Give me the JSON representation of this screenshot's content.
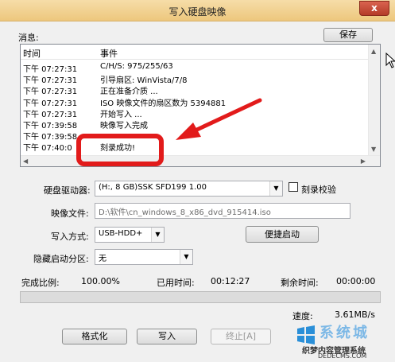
{
  "window": {
    "title": "写入硬盘映像",
    "close_label": "x"
  },
  "messages": {
    "label": "消息:",
    "save_label": "保存",
    "col_time": "时间",
    "col_event": "事件",
    "rows": [
      {
        "time": "下午 07:27:31",
        "event": "C/H/S: 975/255/63"
      },
      {
        "time": "下午 07:27:31",
        "event": "引导扇区: WinVista/7/8"
      },
      {
        "time": "下午 07:27:31",
        "event": "正在准备介质 ..."
      },
      {
        "time": "下午 07:27:31",
        "event": "ISO 映像文件的扇区数为 5394881"
      },
      {
        "time": "下午 07:27:31",
        "event": "开始写入 ..."
      },
      {
        "time": "下午 07:39:58",
        "event": "映像写入完成"
      },
      {
        "time": "下午 07:39:58",
        "event": ""
      },
      {
        "time": "下午 07:40:0",
        "event": "刻录成功!"
      }
    ]
  },
  "form": {
    "drive_label": "硬盘驱动器:",
    "drive_value": "(H:, 8 GB)SSK     SFD199          1.00",
    "verify_label": "刻录校验",
    "image_label": "映像文件:",
    "image_value": "D:\\软件\\cn_windows_8_x86_dvd_915414.iso",
    "write_mode_label": "写入方式:",
    "write_mode_value": "USB-HDD+",
    "quick_boot_label": "便捷启动",
    "hidden_part_label": "隐藏启动分区:",
    "hidden_part_value": "无"
  },
  "status": {
    "done_label": "完成比例:",
    "done_value": "100.00%",
    "elapsed_label": "已用时间:",
    "elapsed_value": "00:12:27",
    "remain_label": "剩余时间:",
    "remain_value": "00:00:00",
    "progress": 1.0,
    "speed_label": "速度:",
    "speed_value": "3.61MB/s"
  },
  "buttons": {
    "format_label": "格式化",
    "write_label": "写入",
    "abort_label": "终止[A]"
  },
  "watermark": {
    "brand": "系统城",
    "line1": "织梦内容管理系统",
    "line2": "DEDECMS.COM"
  },
  "colors": {
    "titlebar": "#edc77d",
    "highlight": "#e21b1b"
  }
}
